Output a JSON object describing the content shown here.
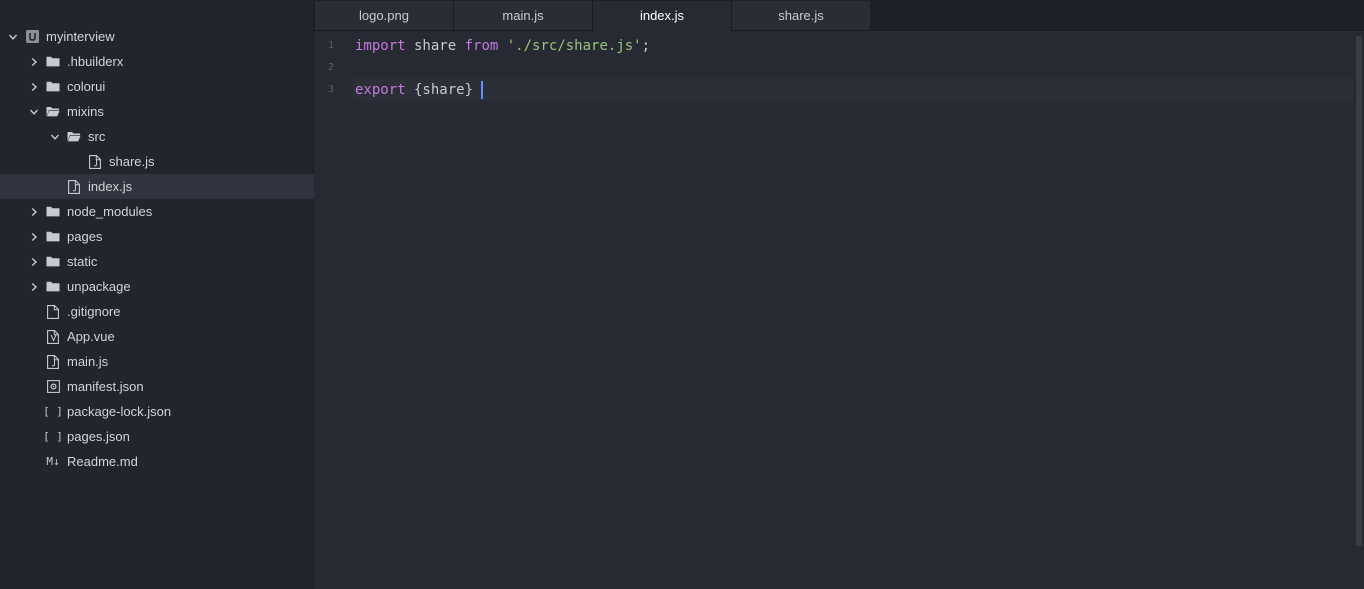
{
  "explorer": {
    "items": [
      {
        "label": "myinterview",
        "kind": "project",
        "expanded": true,
        "depth": 0
      },
      {
        "label": ".hbuilderx",
        "kind": "folder",
        "expanded": false,
        "depth": 1
      },
      {
        "label": "colorui",
        "kind": "folder",
        "expanded": false,
        "depth": 1
      },
      {
        "label": "mixins",
        "kind": "folder",
        "expanded": true,
        "depth": 1
      },
      {
        "label": "src",
        "kind": "folder",
        "expanded": true,
        "depth": 2
      },
      {
        "label": "share.js",
        "kind": "js-file",
        "depth": 3
      },
      {
        "label": "index.js",
        "kind": "js-file",
        "depth": 2,
        "selected": true
      },
      {
        "label": "node_modules",
        "kind": "folder",
        "expanded": false,
        "depth": 1
      },
      {
        "label": "pages",
        "kind": "folder",
        "expanded": false,
        "depth": 1
      },
      {
        "label": "static",
        "kind": "folder",
        "expanded": false,
        "depth": 1
      },
      {
        "label": "unpackage",
        "kind": "folder",
        "expanded": false,
        "depth": 1
      },
      {
        "label": ".gitignore",
        "kind": "file",
        "depth": 1
      },
      {
        "label": "App.vue",
        "kind": "vue-file",
        "depth": 1
      },
      {
        "label": "main.js",
        "kind": "js-file",
        "depth": 1
      },
      {
        "label": "manifest.json",
        "kind": "manifest-file",
        "depth": 1
      },
      {
        "label": "package-lock.json",
        "kind": "json-file",
        "depth": 1
      },
      {
        "label": "pages.json",
        "kind": "json-file",
        "depth": 1
      },
      {
        "label": "Readme.md",
        "kind": "md-file",
        "depth": 1
      }
    ],
    "icon_text": {
      "json": "[ ]",
      "markdown": "M↓"
    }
  },
  "tabs": [
    {
      "label": "logo.png",
      "active": false
    },
    {
      "label": "main.js",
      "active": false
    },
    {
      "label": "index.js",
      "active": true
    },
    {
      "label": "share.js",
      "active": false
    }
  ],
  "editor": {
    "line_numbers": [
      "1",
      "2",
      "3"
    ],
    "lines": [
      [
        {
          "text": "import",
          "cls": "kw"
        },
        {
          "text": " share ",
          "cls": "plain"
        },
        {
          "text": "from",
          "cls": "kw"
        },
        {
          "text": " ",
          "cls": "plain"
        },
        {
          "text": "'./src/share.js'",
          "cls": "str"
        },
        {
          "text": ";",
          "cls": "plain"
        }
      ],
      [],
      [
        {
          "text": "export",
          "cls": "kw"
        },
        {
          "text": " {share}",
          "cls": "plain"
        }
      ]
    ],
    "current_line": 3
  },
  "colors": {
    "sidebar_bg": "#22252c",
    "editor_bg": "#272a33",
    "selection_bg": "#30343e",
    "keyword": "#c678dd",
    "string": "#98c379",
    "caret": "#5f8eff"
  }
}
